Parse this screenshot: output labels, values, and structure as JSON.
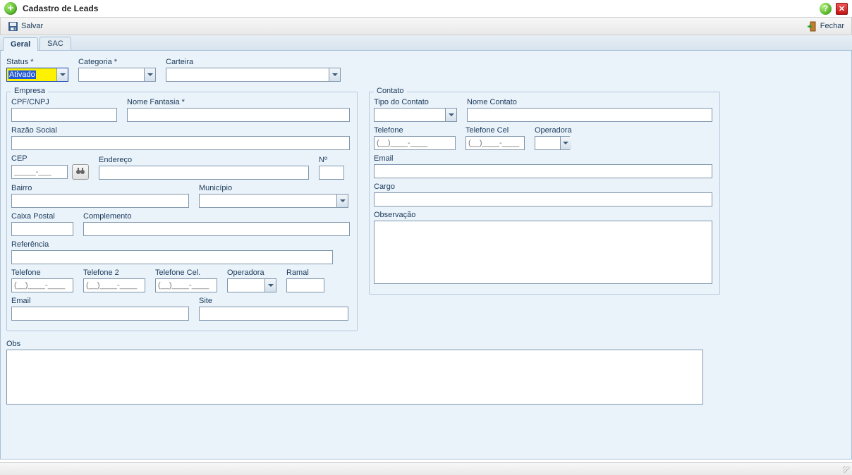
{
  "window": {
    "title": "Cadastro de Leads"
  },
  "toolbar": {
    "save_label": "Salvar",
    "close_label": "Fechar"
  },
  "tabs": [
    "Geral",
    "SAC"
  ],
  "active_tab": 0,
  "top_fields": {
    "status": {
      "label": "Status *",
      "value": "Ativado"
    },
    "categoria": {
      "label": "Categoria *",
      "value": ""
    },
    "carteira": {
      "label": "Carteira",
      "value": ""
    }
  },
  "empresa": {
    "legend": "Empresa",
    "cpf_cnpj": {
      "label": "CPF/CNPJ",
      "value": ""
    },
    "nome_fantasia": {
      "label": "Nome Fantasia *",
      "value": ""
    },
    "razao_social": {
      "label": "Razão Social",
      "value": ""
    },
    "cep": {
      "label": "CEP",
      "value": "",
      "placeholder": "_____-___"
    },
    "endereco": {
      "label": "Endereço",
      "value": ""
    },
    "numero": {
      "label": "Nº",
      "value": ""
    },
    "bairro": {
      "label": "Bairro",
      "value": ""
    },
    "municipio": {
      "label": "Município",
      "value": ""
    },
    "caixa_postal": {
      "label": "Caixa Postal",
      "value": ""
    },
    "complemento": {
      "label": "Complemento",
      "value": ""
    },
    "referencia": {
      "label": "Referência",
      "value": ""
    },
    "telefone": {
      "label": "Telefone",
      "value": "",
      "placeholder": "(__)____-____"
    },
    "telefone2": {
      "label": "Telefone 2",
      "value": "",
      "placeholder": "(__)____-____"
    },
    "telefone_cel": {
      "label": "Telefone Cel.",
      "value": "",
      "placeholder": "(__)____-____"
    },
    "operadora": {
      "label": "Operadora",
      "value": ""
    },
    "ramal": {
      "label": "Ramal",
      "value": ""
    },
    "email": {
      "label": "Email",
      "value": ""
    },
    "site": {
      "label": "Site",
      "value": ""
    }
  },
  "contato": {
    "legend": "Contato",
    "tipo": {
      "label": "Tipo do Contato",
      "value": ""
    },
    "nome": {
      "label": "Nome Contato",
      "value": ""
    },
    "telefone": {
      "label": "Telefone",
      "value": "",
      "placeholder": "(__)____-____"
    },
    "telefone_cel": {
      "label": "Telefone Cel",
      "value": "",
      "placeholder": "(__)____-____"
    },
    "operadora": {
      "label": "Operadora",
      "value": ""
    },
    "email": {
      "label": "Email",
      "value": ""
    },
    "cargo": {
      "label": "Cargo",
      "value": ""
    },
    "observacao": {
      "label": "Observação",
      "value": ""
    }
  },
  "obs": {
    "label": "Obs",
    "value": ""
  }
}
